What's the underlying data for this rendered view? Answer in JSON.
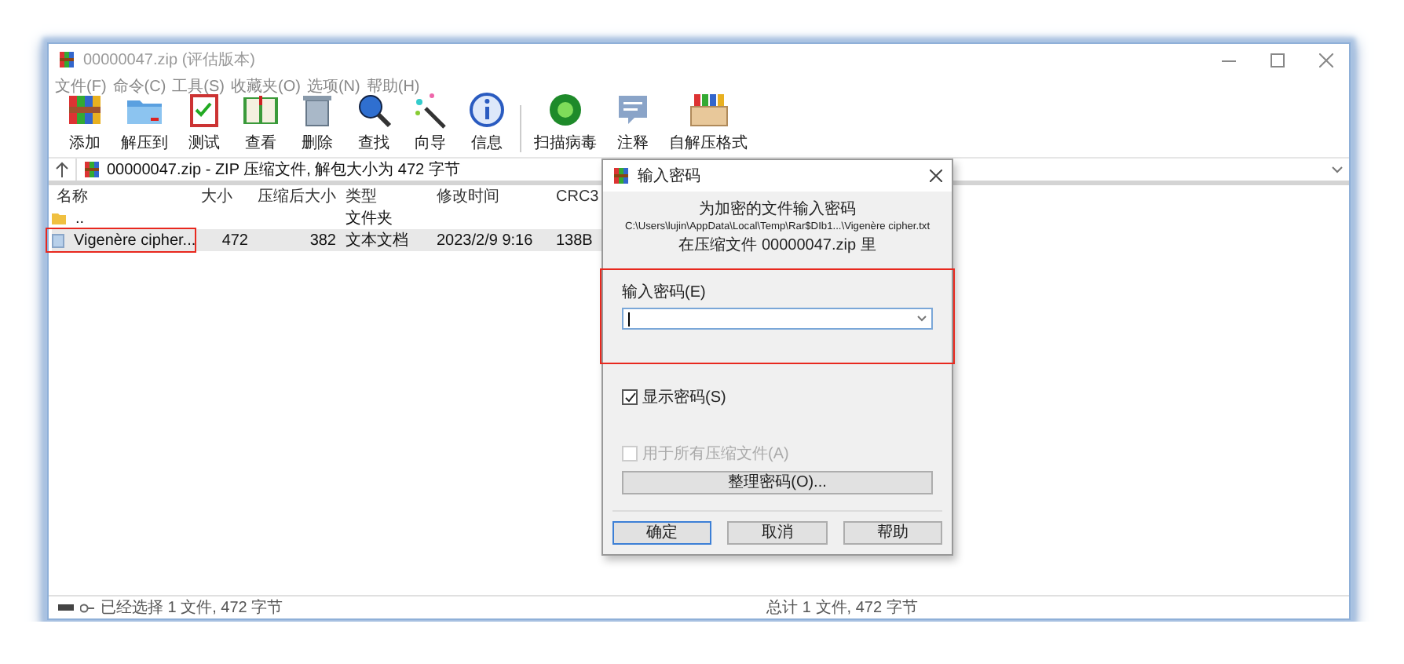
{
  "window": {
    "title": "00000047.zip (评估版本)"
  },
  "menu": [
    "文件(F)",
    "命令(C)",
    "工具(S)",
    "收藏夹(O)",
    "选项(N)",
    "帮助(H)"
  ],
  "toolbar": {
    "groups": [
      [
        "添加",
        "解压到",
        "测试",
        "查看",
        "删除",
        "查找",
        "向导",
        "信息"
      ],
      [
        "扫描病毒",
        "注释",
        "自解压格式"
      ]
    ]
  },
  "address_bar": {
    "path": "00000047.zip - ZIP 压缩文件, 解包大小为 472 字节"
  },
  "file_list": {
    "columns": [
      "名称",
      "大小",
      "压缩后大小",
      "类型",
      "修改时间",
      "CRC3"
    ],
    "rows": [
      {
        "kind": "folder",
        "selected": false,
        "highlighted": false,
        "cells": {
          "name": "..",
          "type": "文件夹"
        }
      },
      {
        "kind": "file",
        "selected": true,
        "highlighted": true,
        "cells": {
          "name": "Vigenère cipher...",
          "size": "472",
          "packed": "382",
          "type": "文本文档",
          "modified": "2023/2/9 9:16",
          "crc": "138B"
        }
      }
    ]
  },
  "status_bar": {
    "left": "已经选择 1 文件, 472 字节",
    "right": "总计 1 文件, 472 字节"
  },
  "dialog": {
    "title": "输入密码",
    "message": [
      "为加密的文件输入密码",
      "C:\\Users\\lujin\\AppData\\Local\\Temp\\Rar$DIb1...\\Vigenère cipher.txt",
      "在压缩文件 00000047.zip 里"
    ],
    "password_label": "输入密码(E)",
    "password_highlighted": true,
    "show_password": {
      "label": "显示密码(S)",
      "checked": true,
      "disabled": false
    },
    "apply_all": {
      "label": "用于所有压缩文件(A)",
      "checked": false,
      "disabled": true
    },
    "organize_button": "整理密码(O)...",
    "buttons": [
      {
        "label": "确定",
        "default": true
      },
      {
        "label": "取消",
        "default": false
      },
      {
        "label": "帮助",
        "default": false
      }
    ]
  }
}
